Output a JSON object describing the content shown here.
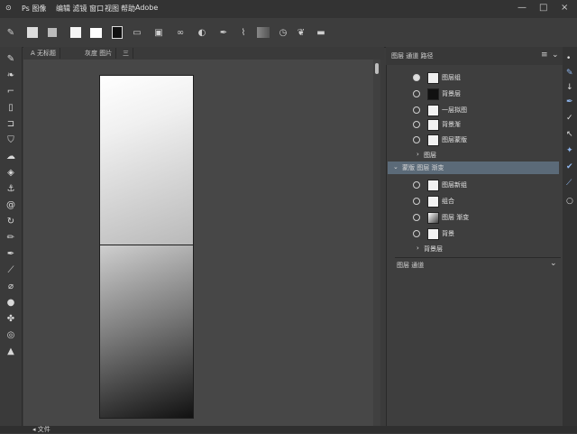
{
  "menu": {
    "items": [
      "Ps 图像",
      "编辑 滤镜 窗口",
      "视图",
      "帮助",
      "Adobe"
    ],
    "window_controls": {
      "minimize": "—",
      "restore": "□",
      "close": "×"
    }
  },
  "options_bar": {
    "icons": [
      "brush-icon",
      "swatch-white",
      "swatch-gray",
      "swatch-black",
      "rect-icon",
      "frame-icon",
      "glasses-icon",
      "bulb-icon",
      "brush2-icon",
      "pen-icon",
      "gradient-icon",
      "clock-icon",
      "dragon-icon",
      "minus-icon"
    ]
  },
  "tabs": [
    "A 无标题",
    "灰度 图片",
    "三"
  ],
  "panel": {
    "title": "图层 通道 路径",
    "layers": [
      {
        "name": "图层组"
      },
      {
        "name": "背景层"
      },
      {
        "name": "一层拟图"
      },
      {
        "name": "背景渐"
      },
      {
        "name": "图层蒙版"
      },
      {
        "name": "图层"
      },
      {
        "name": "蒙版 图层 渐变"
      },
      {
        "name": "图层新组"
      },
      {
        "name": "组合"
      },
      {
        "name": "图层 渐变"
      },
      {
        "name": "背景"
      },
      {
        "name": "背景层"
      }
    ],
    "selected_layer": "蒙版 图层 渐变",
    "section2_title": "图层 通道",
    "section2_collapse": "⌄"
  },
  "statusbar": {
    "text": "◂ 文件"
  }
}
